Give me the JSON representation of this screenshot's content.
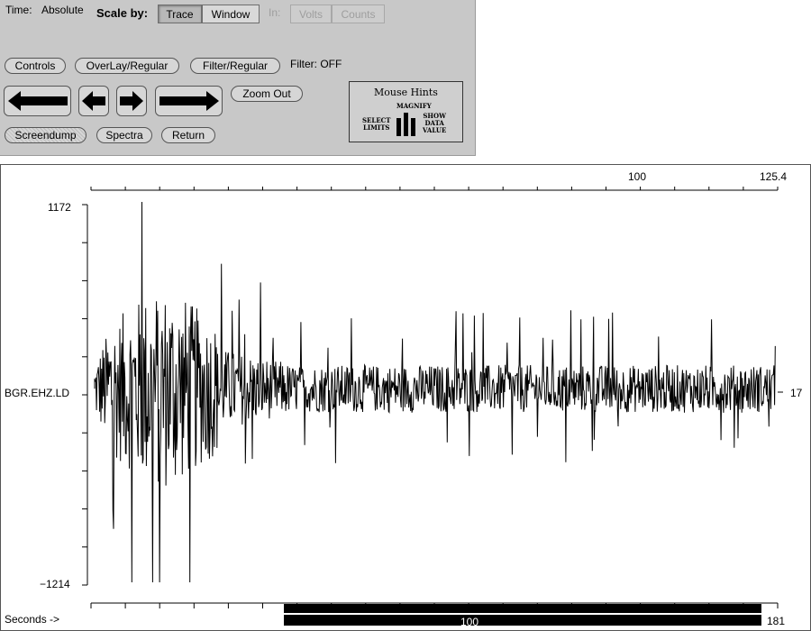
{
  "controls": {
    "time_label": "Time:",
    "time_value": "Absolute",
    "scale_label": "Scale by:",
    "scale_options": [
      "Trace",
      "Window"
    ],
    "in_label": "In:",
    "unit_options": [
      "Volts",
      "Counts"
    ],
    "buttons": {
      "controls": "Controls",
      "overlay": "OverLay/Regular",
      "filter": "Filter/Regular",
      "zoom_out": "Zoom Out",
      "screendump": "Screendump",
      "spectra": "Spectra",
      "return": "Return"
    },
    "filter_status": "Filter: OFF"
  },
  "mouse_hints": {
    "title": "Mouse Hints",
    "middle": "MAGNIFY",
    "left": [
      "SELECT",
      "LIMITS"
    ],
    "right": [
      "SHOW",
      "DATA",
      "VALUE"
    ]
  },
  "plot": {
    "top_ticks": [
      "100",
      "125.4"
    ],
    "y_max": "1172",
    "y_min": "−1214",
    "trace_label": "BGR.EHZ.LD",
    "right_value": "17",
    "x_label": "Seconds ->",
    "bottom_center": "100",
    "bottom_end": "181"
  },
  "chart_data": {
    "type": "line",
    "title": "",
    "xlabel": "Seconds",
    "ylabel": "",
    "series": [
      {
        "name": "BGR.EHZ.LD"
      }
    ],
    "ylim": [
      -1214,
      1172
    ],
    "xlim": [
      0,
      181
    ],
    "x_labeled_ticks": [
      100,
      181
    ],
    "top_axis_ticks": [
      100,
      125.4
    ],
    "baseline": 17,
    "description": "dense seismic waveform, strongest burst near start then steady noise"
  }
}
